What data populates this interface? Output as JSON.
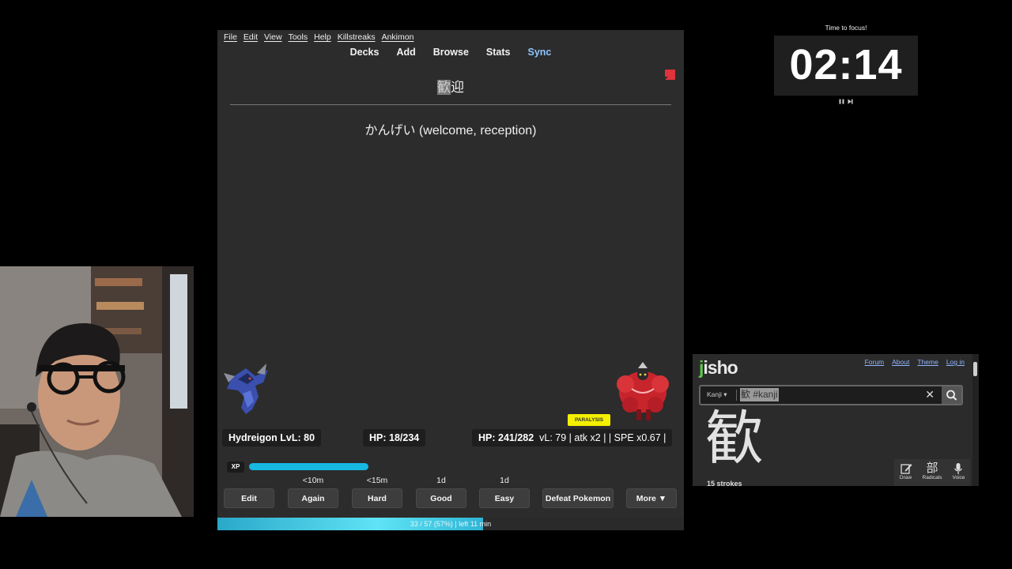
{
  "anki": {
    "menu": [
      "File",
      "Edit",
      "View",
      "Tools",
      "Help",
      "Killstreaks",
      "Ankimon"
    ],
    "toolbar": {
      "decks": "Decks",
      "add": "Add",
      "browse": "Browse",
      "stats": "Stats",
      "sync": "Sync"
    },
    "card": {
      "front_highlight": "歓",
      "front_rest": "迎",
      "back": "かんげい (welcome, reception)"
    },
    "battle": {
      "player_name": "Hydreigon LvL: 80",
      "player_hp": "HP: 18/234",
      "enemy_hp": "HP: 241/282",
      "enemy_stats": "vL: 79 | atk x2 | | SPE x0.67 |",
      "status": "PARALYSIS",
      "xp_label": "XP",
      "xp_fraction": 0.52
    },
    "intervals": {
      "again": "<10m",
      "hard": "<15m",
      "good": "1d",
      "easy": "1d"
    },
    "buttons": {
      "edit": "Edit",
      "again": "Again",
      "hard": "Hard",
      "good": "Good",
      "easy": "Easy",
      "defeat": "Defeat Pokemon",
      "more": "More ▼"
    },
    "progress": {
      "text": "33 / 57 (57%) | left 11 min",
      "fraction": 0.57
    }
  },
  "timer": {
    "title": "Time to focus!",
    "time": "02:14"
  },
  "jisho": {
    "logo_j": "j",
    "logo_rest": "isho",
    "links": [
      "Forum",
      "About",
      "Theme",
      "Log in"
    ],
    "search_type": "Kanji ▾",
    "search_value": "歓 #kanji",
    "clear": "✕",
    "kanji": "歓",
    "strokes": "15 strokes",
    "tools": {
      "draw": "Draw",
      "radicals": "Radicals",
      "radicals_glyph": "部",
      "voice": "Voice"
    }
  },
  "colors": {
    "sync": "#8ec5ff",
    "xp_bar": "#17b8e2",
    "paralysis": "#f4f000",
    "jisho_green": "#5cc64a",
    "flag": "#e0333c"
  }
}
